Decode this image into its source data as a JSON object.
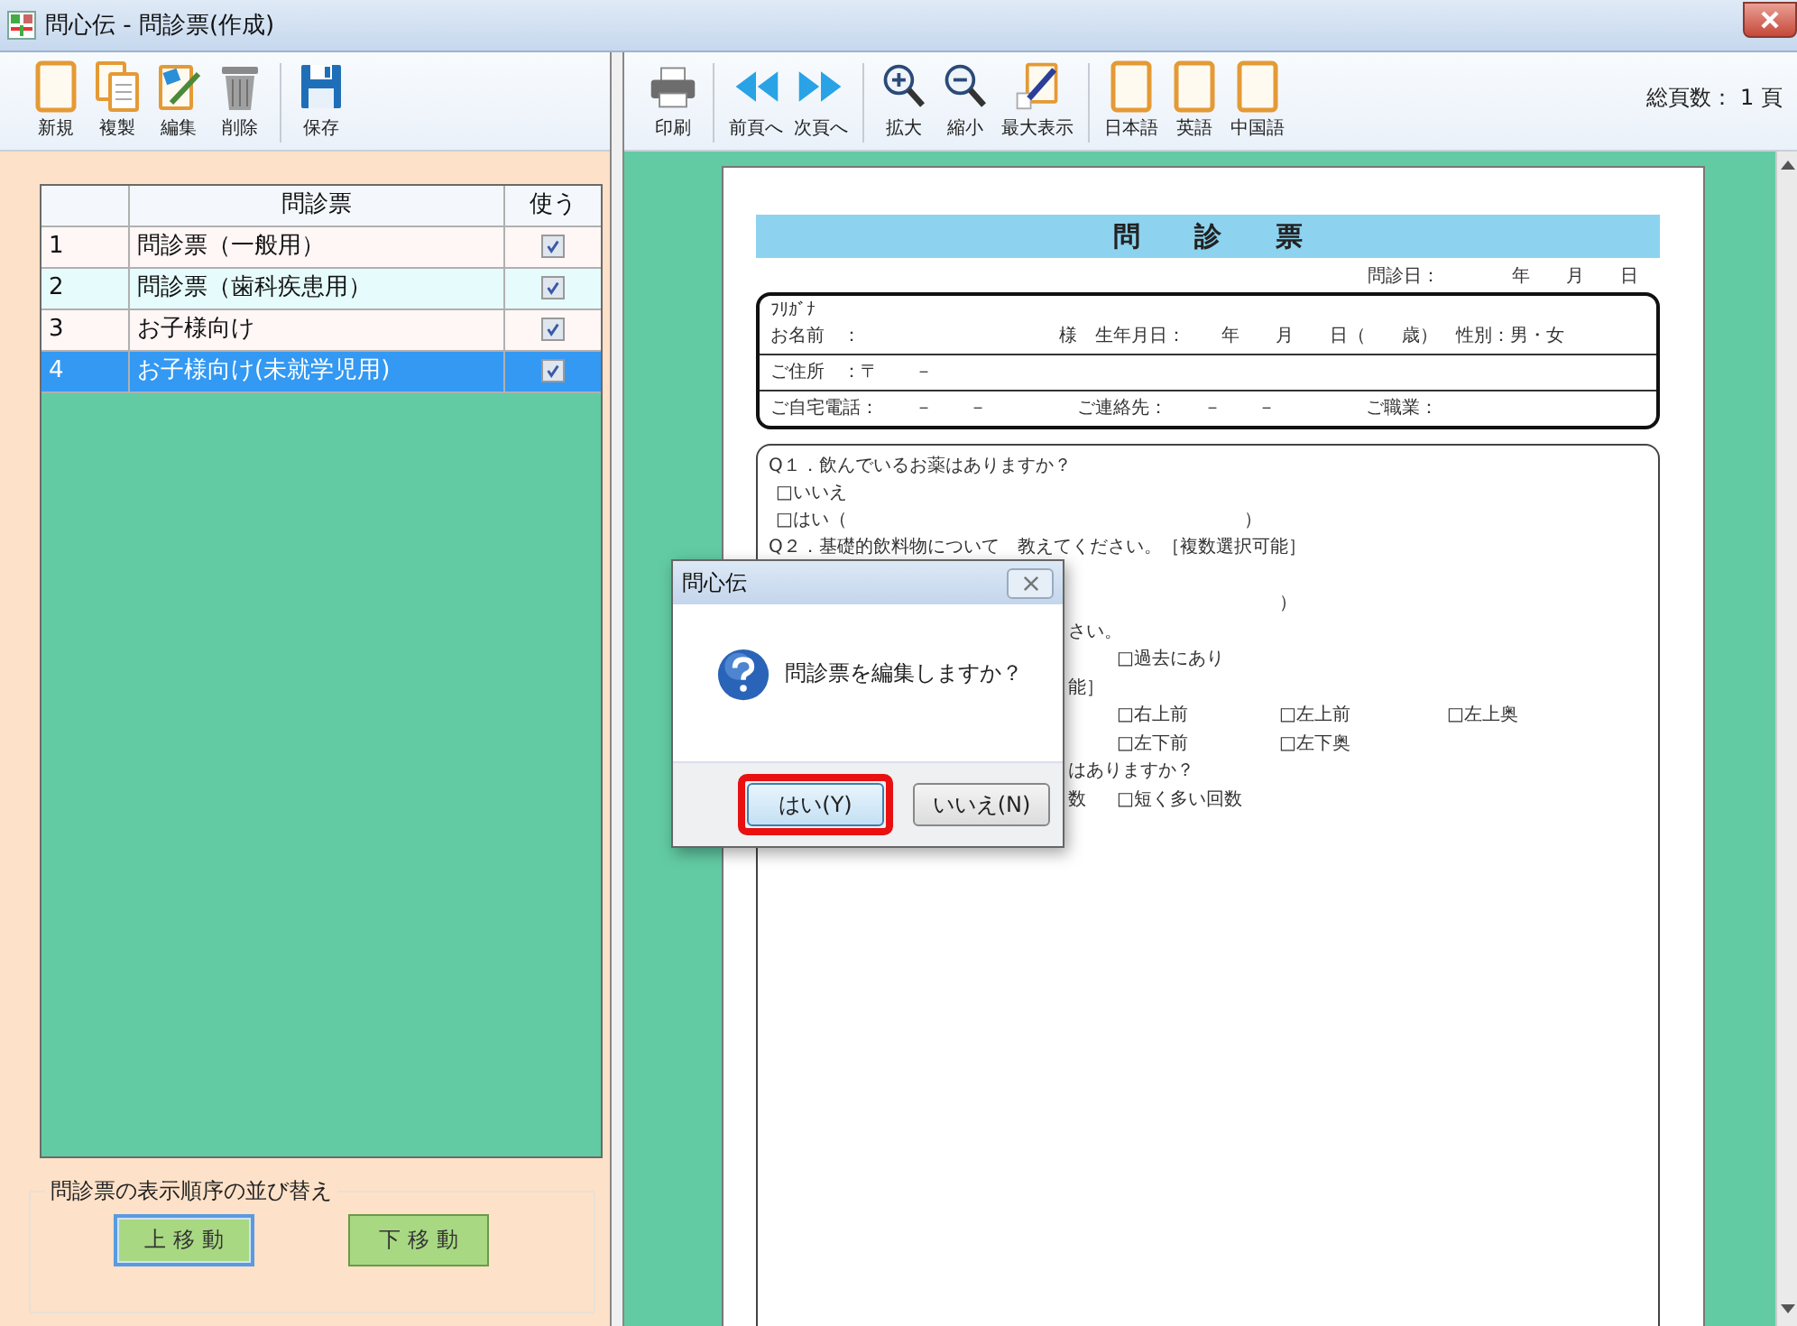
{
  "window": {
    "title": "問心伝 - 問診票(作成)"
  },
  "left_toolbar": [
    [
      {
        "label": "新規",
        "kind": "blank"
      },
      {
        "label": "複製",
        "kind": "copy"
      },
      {
        "label": "編集",
        "kind": "edit"
      },
      {
        "label": "削除",
        "kind": "trash"
      }
    ],
    [
      {
        "label": "保存",
        "kind": "save"
      }
    ]
  ],
  "right_toolbar": [
    [
      {
        "label": "印刷",
        "kind": "print"
      }
    ],
    [
      {
        "label": "前頁へ",
        "kind": "prev"
      },
      {
        "label": "次頁へ",
        "kind": "next"
      }
    ],
    [
      {
        "label": "拡大",
        "kind": "zoomin"
      },
      {
        "label": "縮小",
        "kind": "zoomout"
      },
      {
        "label": "最大表示",
        "kind": "fit"
      }
    ],
    [
      {
        "label": "日本語",
        "kind": "blank"
      },
      {
        "label": "英語",
        "kind": "blank"
      },
      {
        "label": "中国語",
        "kind": "blank"
      }
    ]
  ],
  "page_count": "総頁数： 1 頁",
  "table": {
    "columns": [
      "問診票",
      "使う"
    ],
    "rows": [
      {
        "number": "1",
        "name": "問診票（一般用）",
        "use": true,
        "selected": false
      },
      {
        "number": "2",
        "name": "問診票（歯科疾患用）",
        "use": true,
        "selected": false
      },
      {
        "number": "3",
        "name": "お子様向け",
        "use": true,
        "selected": false
      },
      {
        "number": "4",
        "name": "お子様向け(未就学児用)",
        "use": true,
        "selected": true
      }
    ]
  },
  "reorder_group": {
    "title": "問診票の表示順序の並び替え",
    "buttons": [
      {
        "label": "上 移 動",
        "focused": true
      },
      {
        "label": "下 移 動",
        "focused": false
      }
    ]
  },
  "document": {
    "title": "問　　診　　票",
    "date_line": "問診日：　　　　年　　月　　日",
    "patient_box": [
      [
        "ﾌﾘｶﾞﾅ",
        "お名前　：　　　　　　　　　　　様　生年月日：　　年　　月　　日（　　歳）　性別：男・女"
      ],
      [
        "ご住所　：〒　　－"
      ],
      [
        "ご自宅電話：　　－　　－　　　　　ご連絡先：　　－　　－　　　　　ご職業："
      ]
    ],
    "lines": [
      {
        "kind": "question",
        "text": "Q１．飲んでいるお薬はありますか？"
      },
      {
        "kind": "option",
        "text": "□いいえ"
      },
      {
        "kind": "option",
        "text": "□はい（　　　　　　　　　　　　　　　　　　　　　　）"
      },
      {
        "kind": "question",
        "text": "Q２．基礎的飲料物について　教えてください。［複数選択可能］"
      },
      {
        "kind": "partial",
        "cells": [
          null,
          null,
          "）",
          null
        ]
      },
      {
        "kind": "partial",
        "cells": [
          "さい。",
          null,
          null,
          null
        ]
      },
      {
        "kind": "partial",
        "cells": [
          null,
          "□過去にあり",
          null,
          null
        ]
      },
      {
        "kind": "partial",
        "cells": [
          "能］",
          null,
          null,
          null
        ]
      },
      {
        "kind": "partial",
        "cells": [
          null,
          "□右上前",
          "□左上前",
          "□左上奥"
        ]
      },
      {
        "kind": "partial",
        "cells": [
          null,
          "□左下前",
          "□左下奥",
          null
        ]
      },
      {
        "kind": "partial",
        "cells": [
          "はありますか？",
          null,
          null,
          null
        ]
      },
      {
        "kind": "partial",
        "cells": [
          "数",
          "□短く多い回数",
          null,
          null
        ]
      }
    ]
  },
  "dialog": {
    "title": "問心伝",
    "message": "問診票を編集しますか？",
    "buttons": [
      {
        "label": "はい(Y)",
        "default": true,
        "highlighted": true
      },
      {
        "label": "いいえ(N)",
        "default": false,
        "highlighted": false
      }
    ]
  }
}
